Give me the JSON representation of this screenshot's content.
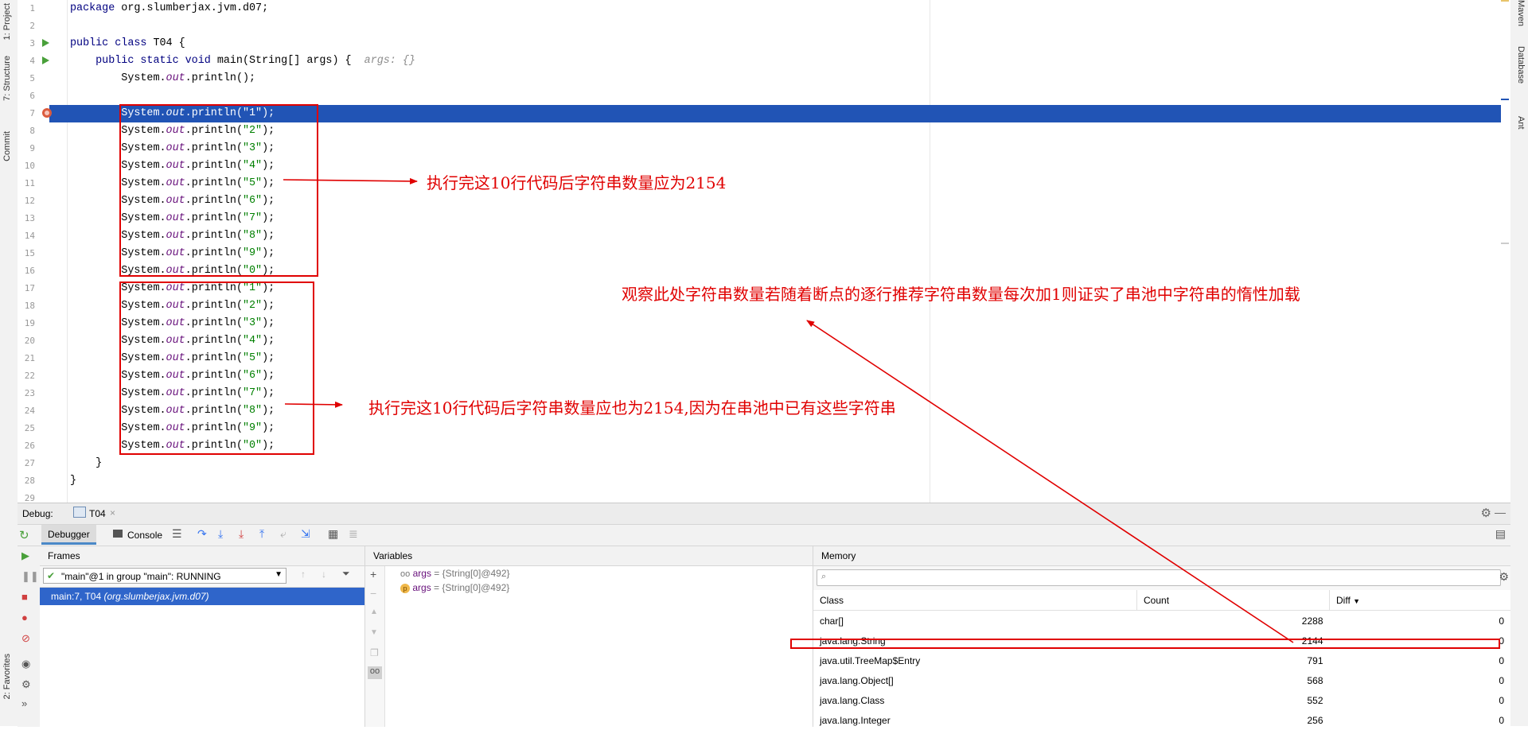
{
  "left_strip": {
    "tabs": [
      "1: Project",
      "7: Structure",
      "Commit",
      "2: Favorites"
    ]
  },
  "right_strip": {
    "tabs": [
      "Maven",
      "Database",
      "Ant"
    ]
  },
  "editor": {
    "lines": [
      {
        "n": "1",
        "tokens": [
          {
            "t": "package ",
            "c": "kw"
          },
          {
            "t": "org.slumberjax.jvm.d07;",
            "c": ""
          }
        ]
      },
      {
        "n": "2",
        "tokens": []
      },
      {
        "n": "3",
        "tokens": [
          {
            "t": "public class ",
            "c": "kw"
          },
          {
            "t": "T04 {",
            "c": ""
          }
        ]
      },
      {
        "n": "4",
        "tokens": [
          {
            "t": "    public static void ",
            "c": "kw"
          },
          {
            "t": "main(String[] args) {  ",
            "c": ""
          },
          {
            "t": "args: {}",
            "c": "hint"
          }
        ]
      },
      {
        "n": "5",
        "tokens": [
          {
            "t": "        System.",
            "c": ""
          },
          {
            "t": "out",
            "c": "fld"
          },
          {
            "t": ".println();",
            "c": ""
          }
        ]
      },
      {
        "n": "6",
        "tokens": []
      },
      {
        "n": "7",
        "tokens": [
          {
            "t": "        System.",
            "c": ""
          },
          {
            "t": "out",
            "c": "fld"
          },
          {
            "t": ".println(",
            "c": ""
          },
          {
            "t": "\"1\"",
            "c": "str"
          },
          {
            "t": ");",
            "c": ""
          }
        ]
      },
      {
        "n": "8",
        "tokens": [
          {
            "t": "        System.",
            "c": ""
          },
          {
            "t": "out",
            "c": "fld"
          },
          {
            "t": ".println(",
            "c": ""
          },
          {
            "t": "\"2\"",
            "c": "str"
          },
          {
            "t": ");",
            "c": ""
          }
        ]
      },
      {
        "n": "9",
        "tokens": [
          {
            "t": "        System.",
            "c": ""
          },
          {
            "t": "out",
            "c": "fld"
          },
          {
            "t": ".println(",
            "c": ""
          },
          {
            "t": "\"3\"",
            "c": "str"
          },
          {
            "t": ");",
            "c": ""
          }
        ]
      },
      {
        "n": "10",
        "tokens": [
          {
            "t": "        System.",
            "c": ""
          },
          {
            "t": "out",
            "c": "fld"
          },
          {
            "t": ".println(",
            "c": ""
          },
          {
            "t": "\"4\"",
            "c": "str"
          },
          {
            "t": ");",
            "c": ""
          }
        ]
      },
      {
        "n": "11",
        "tokens": [
          {
            "t": "        System.",
            "c": ""
          },
          {
            "t": "out",
            "c": "fld"
          },
          {
            "t": ".println(",
            "c": ""
          },
          {
            "t": "\"5\"",
            "c": "str"
          },
          {
            "t": ");",
            "c": ""
          }
        ]
      },
      {
        "n": "12",
        "tokens": [
          {
            "t": "        System.",
            "c": ""
          },
          {
            "t": "out",
            "c": "fld"
          },
          {
            "t": ".println(",
            "c": ""
          },
          {
            "t": "\"6\"",
            "c": "str"
          },
          {
            "t": ");",
            "c": ""
          }
        ]
      },
      {
        "n": "13",
        "tokens": [
          {
            "t": "        System.",
            "c": ""
          },
          {
            "t": "out",
            "c": "fld"
          },
          {
            "t": ".println(",
            "c": ""
          },
          {
            "t": "\"7\"",
            "c": "str"
          },
          {
            "t": ");",
            "c": ""
          }
        ]
      },
      {
        "n": "14",
        "tokens": [
          {
            "t": "        System.",
            "c": ""
          },
          {
            "t": "out",
            "c": "fld"
          },
          {
            "t": ".println(",
            "c": ""
          },
          {
            "t": "\"8\"",
            "c": "str"
          },
          {
            "t": ");",
            "c": ""
          }
        ]
      },
      {
        "n": "15",
        "tokens": [
          {
            "t": "        System.",
            "c": ""
          },
          {
            "t": "out",
            "c": "fld"
          },
          {
            "t": ".println(",
            "c": ""
          },
          {
            "t": "\"9\"",
            "c": "str"
          },
          {
            "t": ");",
            "c": ""
          }
        ]
      },
      {
        "n": "16",
        "tokens": [
          {
            "t": "        System.",
            "c": ""
          },
          {
            "t": "out",
            "c": "fld"
          },
          {
            "t": ".println(",
            "c": ""
          },
          {
            "t": "\"0\"",
            "c": "str"
          },
          {
            "t": ");",
            "c": ""
          }
        ]
      },
      {
        "n": "17",
        "tokens": [
          {
            "t": "        System.",
            "c": ""
          },
          {
            "t": "out",
            "c": "fld"
          },
          {
            "t": ".println(",
            "c": ""
          },
          {
            "t": "\"1\"",
            "c": "str"
          },
          {
            "t": ");",
            "c": ""
          }
        ]
      },
      {
        "n": "18",
        "tokens": [
          {
            "t": "        System.",
            "c": ""
          },
          {
            "t": "out",
            "c": "fld"
          },
          {
            "t": ".println(",
            "c": ""
          },
          {
            "t": "\"2\"",
            "c": "str"
          },
          {
            "t": ");",
            "c": ""
          }
        ]
      },
      {
        "n": "19",
        "tokens": [
          {
            "t": "        System.",
            "c": ""
          },
          {
            "t": "out",
            "c": "fld"
          },
          {
            "t": ".println(",
            "c": ""
          },
          {
            "t": "\"3\"",
            "c": "str"
          },
          {
            "t": ");",
            "c": ""
          }
        ]
      },
      {
        "n": "20",
        "tokens": [
          {
            "t": "        System.",
            "c": ""
          },
          {
            "t": "out",
            "c": "fld"
          },
          {
            "t": ".println(",
            "c": ""
          },
          {
            "t": "\"4\"",
            "c": "str"
          },
          {
            "t": ");",
            "c": ""
          }
        ]
      },
      {
        "n": "21",
        "tokens": [
          {
            "t": "        System.",
            "c": ""
          },
          {
            "t": "out",
            "c": "fld"
          },
          {
            "t": ".println(",
            "c": ""
          },
          {
            "t": "\"5\"",
            "c": "str"
          },
          {
            "t": ");",
            "c": ""
          }
        ]
      },
      {
        "n": "22",
        "tokens": [
          {
            "t": "        System.",
            "c": ""
          },
          {
            "t": "out",
            "c": "fld"
          },
          {
            "t": ".println(",
            "c": ""
          },
          {
            "t": "\"6\"",
            "c": "str"
          },
          {
            "t": ");",
            "c": ""
          }
        ]
      },
      {
        "n": "23",
        "tokens": [
          {
            "t": "        System.",
            "c": ""
          },
          {
            "t": "out",
            "c": "fld"
          },
          {
            "t": ".println(",
            "c": ""
          },
          {
            "t": "\"7\"",
            "c": "str"
          },
          {
            "t": ");",
            "c": ""
          }
        ]
      },
      {
        "n": "24",
        "tokens": [
          {
            "t": "        System.",
            "c": ""
          },
          {
            "t": "out",
            "c": "fld"
          },
          {
            "t": ".println(",
            "c": ""
          },
          {
            "t": "\"8\"",
            "c": "str"
          },
          {
            "t": ");",
            "c": ""
          }
        ]
      },
      {
        "n": "25",
        "tokens": [
          {
            "t": "        System.",
            "c": ""
          },
          {
            "t": "out",
            "c": "fld"
          },
          {
            "t": ".println(",
            "c": ""
          },
          {
            "t": "\"9\"",
            "c": "str"
          },
          {
            "t": ");",
            "c": ""
          }
        ]
      },
      {
        "n": "26",
        "tokens": [
          {
            "t": "        System.",
            "c": ""
          },
          {
            "t": "out",
            "c": "fld"
          },
          {
            "t": ".println(",
            "c": ""
          },
          {
            "t": "\"0\"",
            "c": "str"
          },
          {
            "t": ");",
            "c": ""
          }
        ]
      },
      {
        "n": "27",
        "tokens": [
          {
            "t": "    }",
            "c": ""
          }
        ]
      },
      {
        "n": "28",
        "tokens": [
          {
            "t": "}",
            "c": ""
          }
        ]
      },
      {
        "n": "29",
        "tokens": []
      }
    ],
    "current_line": "7",
    "run_lines": [
      "3",
      "4"
    ],
    "breakpoint_line": "7"
  },
  "annotations": {
    "a1": "执行完这10行代码后字符串数量应为2154",
    "a2": "观察此处字符串数量若随着断点的逐行推荐字符串数量每次加1则证实了串池中字符串的惰性加载",
    "a3": "执行完这10行代码后字符串数量应也为2154,因为在串池中已有这些字符串"
  },
  "debug": {
    "label": "Debug:",
    "session_tab": "T04",
    "tabs": {
      "debugger": "Debugger",
      "console": "Console"
    },
    "frames": {
      "title": "Frames",
      "thread": "\"main\"@1 in group \"main\": RUNNING",
      "items": [
        {
          "label": "main:7, T04",
          "detail": "(org.slumberjax.jvm.d07)"
        }
      ]
    },
    "variables": {
      "title": "Variables",
      "items": [
        {
          "icon": "oo",
          "name": "args",
          "value": "= {String[0]@492}"
        },
        {
          "icon": "p",
          "name": "args",
          "value": "= {String[0]@492}"
        }
      ]
    },
    "memory": {
      "title": "Memory",
      "search_placeholder": "",
      "columns": [
        "Class",
        "Count",
        "Diff"
      ],
      "rows": [
        {
          "class": "char[]",
          "count": "2288",
          "diff": "0"
        },
        {
          "class": "java.lang.String",
          "count": "2144",
          "diff": "0"
        },
        {
          "class": "java.util.TreeMap$Entry",
          "count": "791",
          "diff": "0"
        },
        {
          "class": "java.lang.Object[]",
          "count": "568",
          "diff": "0"
        },
        {
          "class": "java.lang.Class",
          "count": "552",
          "diff": "0"
        },
        {
          "class": "java.lang.Integer",
          "count": "256",
          "diff": "0"
        }
      ]
    }
  },
  "colors": {
    "annotation_red": "#e00000",
    "current_line_bg": "#2154b5",
    "selection_blue": "#2f65ca"
  }
}
